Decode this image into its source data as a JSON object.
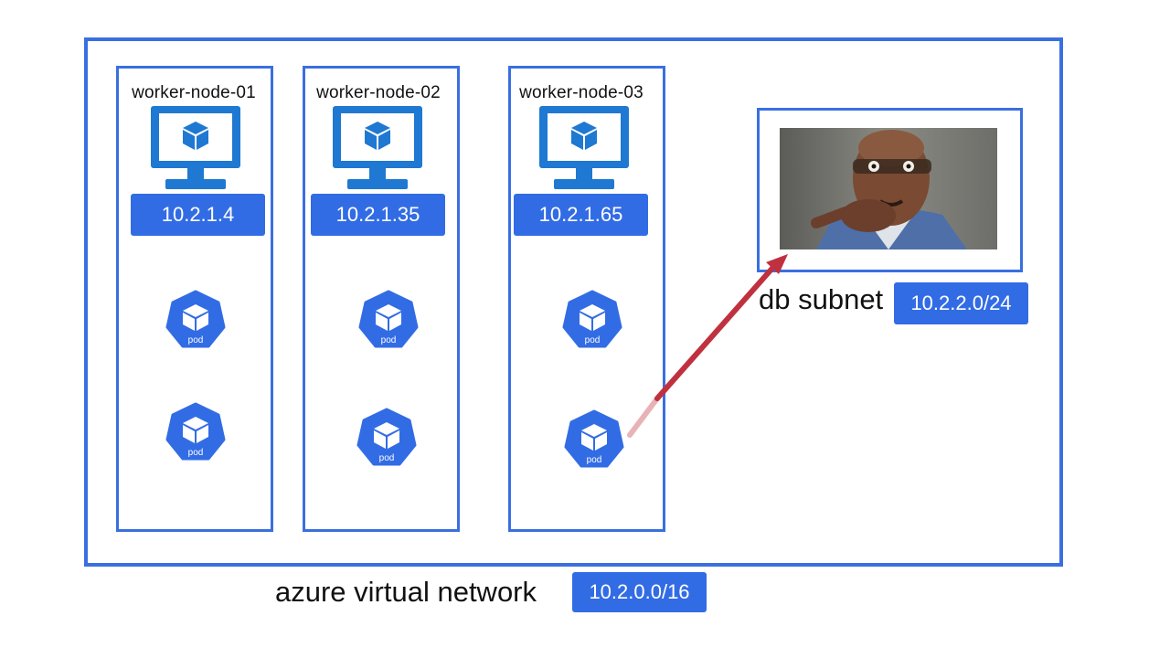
{
  "nodes": [
    {
      "name": "worker-node-01",
      "ip": "10.2.1.4",
      "pods": [
        "pod",
        "pod"
      ]
    },
    {
      "name": "worker-node-02",
      "ip": "10.2.1.35",
      "pods": [
        "pod",
        "pod"
      ]
    },
    {
      "name": "worker-node-03",
      "ip": "10.2.1.65",
      "pods": [
        "pod",
        "pod"
      ]
    }
  ],
  "db_subnet": {
    "label": "db subnet",
    "cidr": "10.2.2.0/24"
  },
  "vnet": {
    "label": "azure virtual network",
    "cidr": "10.2.0.0/16"
  },
  "colors": {
    "accent": "#3a6fe0",
    "badge": "#326ce5",
    "monitor": "#1f78d1",
    "arrow": "#c0313f",
    "arrow_tail": "#e8b3b6"
  },
  "icons": {
    "node_icon": "monitor-cube-icon",
    "pod_icon": "kubernetes-pod-icon",
    "arrow": "connection-arrow-icon",
    "photo": "reaction-photo"
  }
}
